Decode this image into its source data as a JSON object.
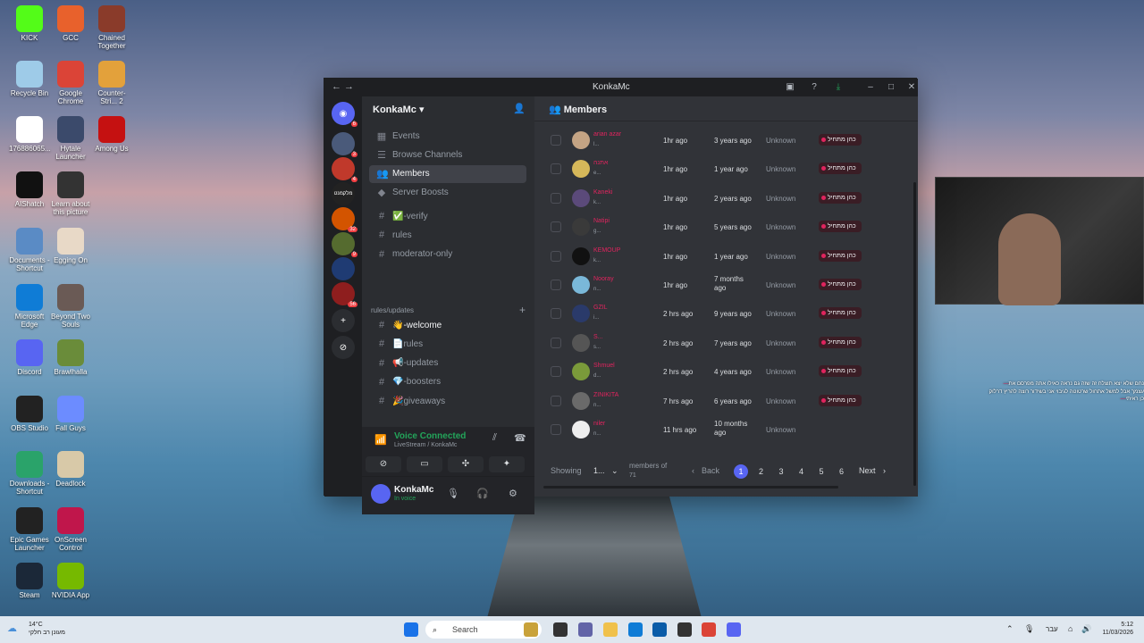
{
  "desktop": {
    "icons": [
      {
        "label": "KICK",
        "icon": "kick-icon",
        "color": "#53fc18"
      },
      {
        "label": "GCC",
        "icon": "gcc-icon",
        "color": "#e8612c"
      },
      {
        "label": "Chained Together",
        "icon": "chained-icon",
        "color": "#8a3b2a"
      },
      {
        "label": "Recycle Bin",
        "icon": "recycle-bin-icon",
        "color": "#9ecbe8"
      },
      {
        "label": "Google Chrome",
        "icon": "chrome-icon",
        "color": "#db4437"
      },
      {
        "label": "Counter-Stri... 2",
        "icon": "cs2-icon",
        "color": "#e3a13b"
      },
      {
        "label": "176886065...",
        "icon": "file-icon",
        "color": "#ffffff"
      },
      {
        "label": "Hytale Launcher",
        "icon": "hytale-icon",
        "color": "#3b4a6b"
      },
      {
        "label": "Among Us",
        "icon": "among-us-icon",
        "color": "#c51111"
      },
      {
        "label": "AIShatch",
        "icon": "aishatch-icon",
        "color": "#111111"
      },
      {
        "label": "Learn about this picture",
        "icon": "camera-icon",
        "color": "#333333"
      },
      {
        "label": "Documents - Shortcut",
        "icon": "documents-icon",
        "color": "#5a8bc5"
      },
      {
        "label": "Egging On",
        "icon": "egg-icon",
        "color": "#e8d9c7"
      },
      {
        "label": "Microsoft Edge",
        "icon": "edge-icon",
        "color": "#0f7cd6"
      },
      {
        "label": "Beyond Two Souls",
        "icon": "beyond-icon",
        "color": "#6a5a55"
      },
      {
        "label": "Discord",
        "icon": "discord-icon",
        "color": "#5865f2"
      },
      {
        "label": "Brawlhalla",
        "icon": "brawlhalla-icon",
        "color": "#6a8c3a"
      },
      {
        "label": "OBS Studio",
        "icon": "obs-icon",
        "color": "#222222"
      },
      {
        "label": "Fall Guys",
        "icon": "fall-guys-icon",
        "color": "#6c8cff"
      },
      {
        "label": "Downloads - Shortcut",
        "icon": "downloads-icon",
        "color": "#2aa36a"
      },
      {
        "label": "Deadlock",
        "icon": "deadlock-icon",
        "color": "#d8c9a8"
      },
      {
        "label": "Epic Games Launcher",
        "icon": "epic-icon",
        "color": "#222222"
      },
      {
        "label": "OnScreen Control",
        "icon": "onscreen-icon",
        "color": "#c0164b"
      },
      {
        "label": "Steam",
        "icon": "steam-icon",
        "color": "#1b2838"
      },
      {
        "label": "NVIDIA App",
        "icon": "nvidia-icon",
        "color": "#76b900"
      }
    ]
  },
  "window": {
    "title": "KonkaMc",
    "server_name": "KonkaMc",
    "nav_items": [
      {
        "label": "Events",
        "icon": "calendar-icon"
      },
      {
        "label": "Browse Channels",
        "icon": "browse-icon"
      },
      {
        "label": "Members",
        "icon": "members-icon",
        "active": true
      },
      {
        "label": "Server Boosts",
        "icon": "boost-icon"
      }
    ],
    "channels": [
      {
        "label": "✅-verify",
        "icon": "hash-icon"
      },
      {
        "label": "rules",
        "icon": "hash-icon"
      },
      {
        "label": "moderator-only",
        "icon": "hash-icon"
      }
    ],
    "category": "rules/updates",
    "category_channels": [
      {
        "label": "👋-welcome",
        "unread": true
      },
      {
        "label": "📄rules"
      },
      {
        "label": "📢-updates"
      },
      {
        "label": "💎-boosters"
      },
      {
        "label": "🎉giveaways"
      }
    ],
    "voice": {
      "status": "Voice Connected",
      "sub": "LiveStream / KonkaMc"
    },
    "user": {
      "name": "KonkaMc",
      "status": "In voice"
    },
    "members_title": "Members",
    "members": [
      {
        "name": "arian azar",
        "sub": "l...",
        "joined": "1hr ago",
        "account_age": "3 years ago",
        "method": "Unknown",
        "role": "כהן מתחיל",
        "color": "#c4a484"
      },
      {
        "name": "אתנה",
        "sub": "e...",
        "joined": "1hr ago",
        "account_age": "1 year ago",
        "method": "Unknown",
        "role": "כהן מתחיל",
        "color": "#d6b85a"
      },
      {
        "name": "Kaneki",
        "sub": "k...",
        "joined": "1hr ago",
        "account_age": "2 years ago",
        "method": "Unknown",
        "role": "כהן מתחיל",
        "color": "#5b4a7a"
      },
      {
        "name": "Natipi",
        "sub": "g...",
        "joined": "1hr ago",
        "account_age": "5 years ago",
        "method": "Unknown",
        "role": "כהן מתחיל",
        "color": "#3a3a3a"
      },
      {
        "name": "KEMOUP",
        "sub": "k...",
        "joined": "1hr ago",
        "account_age": "1 year ago",
        "method": "Unknown",
        "role": "כהן מתחיל",
        "color": "#111111"
      },
      {
        "name": "Nooray",
        "sub": "n...",
        "joined": "1hr ago",
        "account_age": "7 months ago",
        "method": "Unknown",
        "role": "כהן מתחיל",
        "color": "#7ab8d9"
      },
      {
        "name": "GZIL",
        "sub": "i...",
        "joined": "2 hrs ago",
        "account_age": "9 years ago",
        "method": "Unknown",
        "role": "כהן מתחיל",
        "color": "#2a3a6a"
      },
      {
        "name": "S...",
        "sub": "s...",
        "joined": "2 hrs ago",
        "account_age": "7 years ago",
        "method": "Unknown",
        "role": "כהן מתחיל",
        "color": "#555555"
      },
      {
        "name": "Shmuel",
        "sub": "d...",
        "joined": "2 hrs ago",
        "account_age": "4 years ago",
        "method": "Unknown",
        "role": "כהן מתחיל",
        "color": "#7a9a3a"
      },
      {
        "name": "ZINIKITA",
        "sub": "n...",
        "joined": "7 hrs ago",
        "account_age": "6 years ago",
        "method": "Unknown",
        "role": "כהן מתחיל",
        "color": "#6a6a6a"
      },
      {
        "name": "niler",
        "sub": "n...",
        "joined": "11 hrs ago",
        "account_age": "10 months ago",
        "method": "Unknown",
        "role": "",
        "color": "#eeeeee"
      }
    ],
    "pager": {
      "showing": "Showing",
      "per_page": "1...",
      "members_of": "members of",
      "total": "71",
      "back": "Back",
      "pages": [
        "1",
        "2",
        "3",
        "4",
        "5",
        "6"
      ],
      "current": "1",
      "next": "Next"
    }
  },
  "overlay": {
    "lines": [
      {
        "name": "—",
        "text": "נחם שלא יצא תוצלח זה שזה גם נראה כאילו אתה מפרסם את"
      },
      {
        "name": "",
        "text": "עצמך אבל למשל אתחול שרטוטה לגיבוי אני בשידור רוצה להריץ דרלוק"
      },
      {
        "name": "—",
        "text": "כן ראיתי"
      }
    ]
  },
  "taskbar": {
    "weather_temp": "14°C",
    "weather_text": "מעונן רב חלקי",
    "search": "Search",
    "lang": "עבר",
    "time": "5:12",
    "date": "11/03/2026"
  }
}
